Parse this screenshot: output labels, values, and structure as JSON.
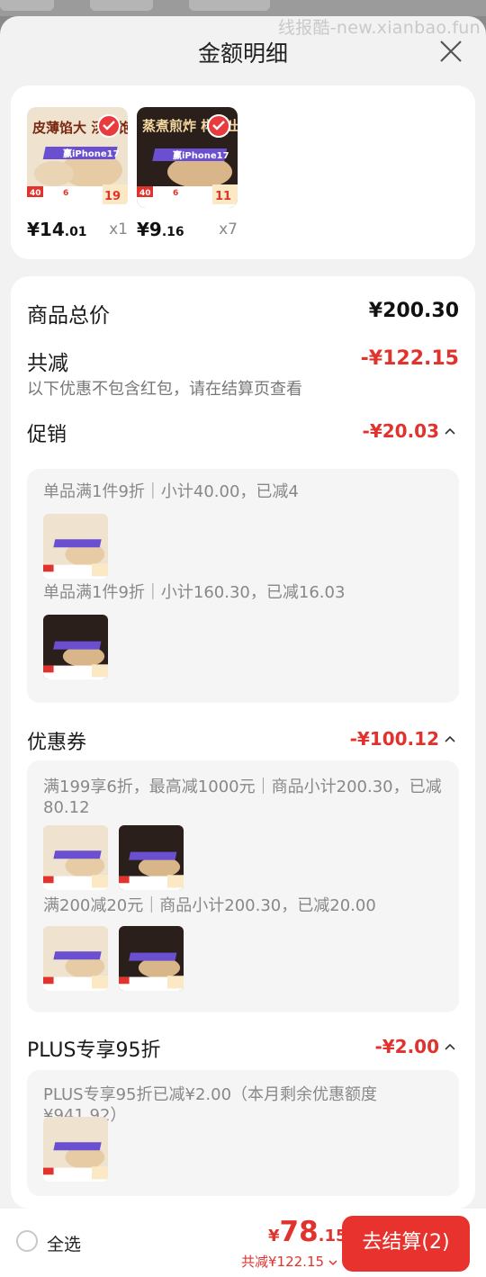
{
  "watermark": "线报酷-new.xianbao.fun",
  "sheet": {
    "title": "金额明细"
  },
  "products": [
    {
      "price_int": "¥14",
      "price_dec": ".01",
      "qty": "x1",
      "image": "dumpling-soup-promo"
    },
    {
      "price_int": "¥9",
      "price_dec": ".16",
      "qty": "x7",
      "image": "dumpling-dark-promo"
    }
  ],
  "summary": {
    "total_label": "商品总价",
    "total_value": "¥200.30",
    "reduce_label": "共减",
    "reduce_value": "-¥122.15",
    "note": "以下优惠不包含红包，请在结算页查看"
  },
  "promotion": {
    "label": "促销",
    "value": "-¥20.03",
    "rules": [
      {
        "text": "单品满1件9折｜小计40.00，已减4"
      },
      {
        "text": "单品满1件9折｜小计160.30，已减16.03"
      }
    ]
  },
  "coupon": {
    "label": "优惠券",
    "value": "-¥100.12",
    "rules": [
      {
        "text": "满199享6折，最高减1000元｜商品小计200.30，已减80.12"
      },
      {
        "text": "满200减20元｜商品小计200.30，已减20.00"
      }
    ]
  },
  "plus": {
    "label": "PLUS专享95折",
    "value": "-¥2.00",
    "rule": "PLUS专享95折已减¥2.00（本月剩余优惠额度¥941.92）"
  },
  "bottom_bar": {
    "select_all": "全选",
    "total_cur": "¥",
    "total_int": "78",
    "total_dec": ".15",
    "discount": "共减¥122.15",
    "checkout": "去结算(2)"
  },
  "colors": {
    "accent_red": "#e1332e",
    "checkout_bg": "#e8322e"
  },
  "thumb_labels": {
    "light_title": "皮薄馅大 汤汁饱满",
    "dark_title": "蒸煮煎炸 样样出色",
    "banner": "赢iPhone17",
    "num_40": "40",
    "num_6": "6",
    "price_light": "19",
    "price_dark": "11",
    "price_suffix": "9"
  }
}
